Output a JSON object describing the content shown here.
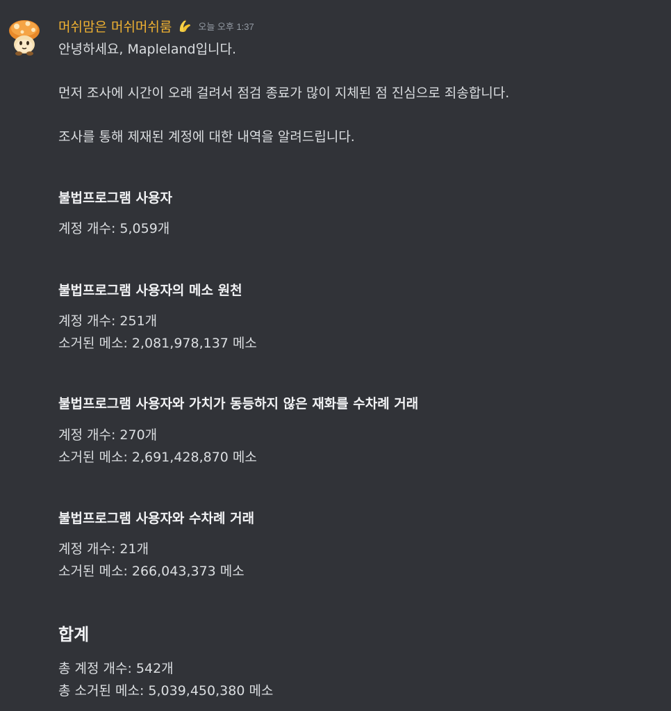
{
  "message": {
    "author": "머쉬맘은 머쉬머쉬룸",
    "timestamp": "오늘 오후 1:37",
    "colors": {
      "background": "#313338",
      "username": "#f0b232",
      "text": "#dbdee1",
      "heading": "#f2f3f5",
      "muted": "#949ba4"
    },
    "icons": {
      "avatar": "orange-mushroom-avatar",
      "role": "banana-role-icon"
    },
    "greeting": "안녕하세요, Mapleland입니다.",
    "apology": "먼저 조사에 시간이 오래 걸려서 점검 종료가 많이 지체된 점 진심으로 죄송합니다.",
    "intro": "조사를 통해 제재된 계정에 대한 내역을 알려드립니다.",
    "sections": [
      {
        "title": "불법프로그램 사용자",
        "accounts": "계정 개수: 5,059개"
      },
      {
        "title": "불법프로그램 사용자의 메소 원천",
        "accounts": "계정 개수: 251개",
        "meso": "소거된 메소: 2,081,978,137 메소"
      },
      {
        "title": "불법프로그램 사용자와 가치가 동등하지 않은 재화를 수차례 거래",
        "accounts": "계정 개수: 270개",
        "meso": "소거된 메소: 2,691,428,870 메소"
      },
      {
        "title": "불법프로그램 사용자와 수차례 거래",
        "accounts": "계정 개수: 21개",
        "meso": "소거된 메소: 266,043,373 메소"
      }
    ],
    "total": {
      "title": "합계",
      "accounts": "총 계정 개수: 542개",
      "meso": "총 소거된 메소: 5,039,450,380 메소"
    }
  }
}
